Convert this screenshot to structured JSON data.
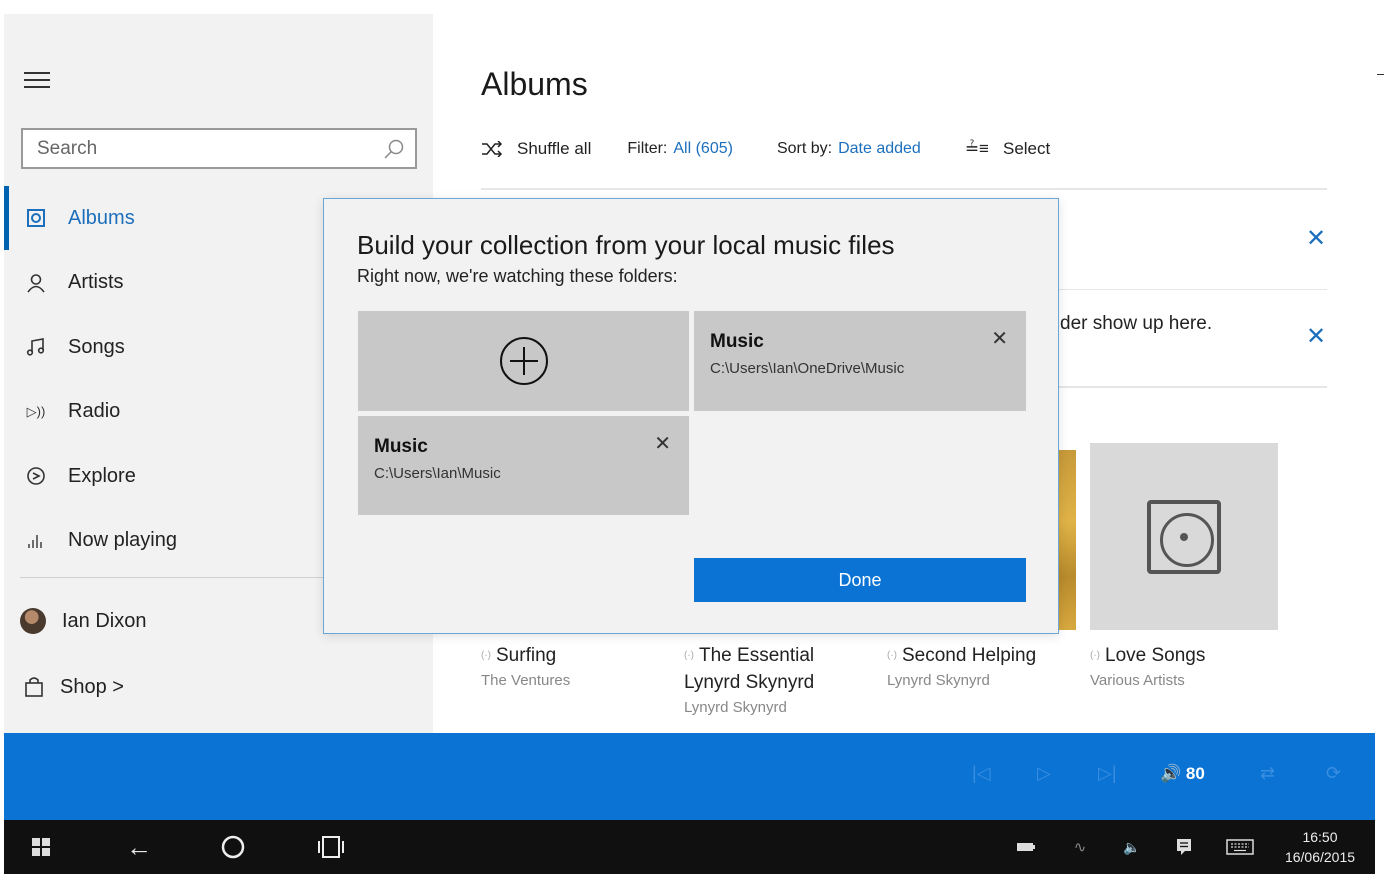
{
  "sidebar": {
    "search_placeholder": "Search",
    "items": [
      {
        "label": "Albums",
        "icon": "album-icon"
      },
      {
        "label": "Artists",
        "icon": "person-icon"
      },
      {
        "label": "Songs",
        "icon": "music-note-icon"
      },
      {
        "label": "Radio",
        "icon": "radio-icon"
      },
      {
        "label": "Explore",
        "icon": "compass-icon"
      },
      {
        "label": "Now playing",
        "icon": "equalizer-icon"
      }
    ],
    "user_name": "Ian Dixon",
    "shop_label": "Shop >"
  },
  "main": {
    "title": "Albums",
    "toolbar": {
      "shuffle_label": "Shuffle all",
      "filter_label": "Filter:",
      "filter_value": "All (605)",
      "sort_label": "Sort by:",
      "sort_value": "Date added",
      "select_label": "Select"
    },
    "notice_text": "der show up here.",
    "albums": [
      {
        "title": "Surfing",
        "title_line2": "",
        "artist": "The Ventures"
      },
      {
        "title": "The Essential",
        "title_line2": "Lynyrd Skynyrd",
        "artist": "Lynyrd Skynyrd"
      },
      {
        "title": "Second Helping",
        "title_line2": "",
        "artist": "Lynyrd Skynyrd"
      },
      {
        "title": "Love Songs",
        "title_line2": "",
        "artist": "Various Artists"
      }
    ]
  },
  "dialog": {
    "title": "Build your collection from your local music files",
    "subtitle": "Right now, we're watching these folders:",
    "folders": [
      {
        "name": "Music",
        "path": "C:\\Users\\Ian\\OneDrive\\Music"
      },
      {
        "name": "Music",
        "path": "C:\\Users\\Ian\\Music"
      }
    ],
    "done_label": "Done"
  },
  "player": {
    "volume": "80"
  },
  "taskbar": {
    "time": "16:50",
    "date": "16/06/2015"
  },
  "colors": {
    "accent": "#0a73d4",
    "link": "#1c6fbd",
    "sidebar_bg": "#f2f2f2",
    "tile_bg": "#c8c8c8",
    "taskbar_bg": "#101010"
  }
}
